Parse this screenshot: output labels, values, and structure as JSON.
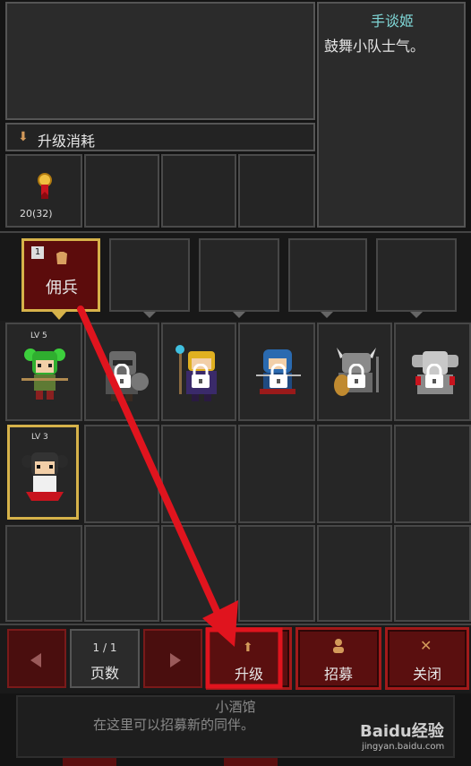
{
  "hero": {
    "name": "手谈姬",
    "desc": "鼓舞小队士气。"
  },
  "upgrade_cost": {
    "label": "升级消耗",
    "medal_count": "20(32)"
  },
  "category_tabs": [
    {
      "label": "佣兵",
      "badge": "1",
      "active": true
    }
  ],
  "units": [
    {
      "level": "LV 5",
      "locked": false
    },
    {
      "level": "",
      "locked": true
    },
    {
      "level": "",
      "locked": true
    },
    {
      "level": "",
      "locked": true
    },
    {
      "level": "",
      "locked": true
    },
    {
      "level": "",
      "locked": true
    },
    {
      "level": "LV 3",
      "locked": false
    }
  ],
  "pager": {
    "page": "1 / 1",
    "label": "页数"
  },
  "buttons": {
    "upgrade": "升级",
    "recruit": "招募",
    "close": "关闭"
  },
  "footer": {
    "title": "小酒馆",
    "desc": "在这里可以招募新的同伴。"
  },
  "watermark": {
    "brand": "Baidu经验",
    "url": "jingyan.baidu.com"
  },
  "colors": {
    "accent_red": "#c8141e",
    "gold_border": "#d6b24a",
    "hero_name": "#7fd6d6"
  }
}
